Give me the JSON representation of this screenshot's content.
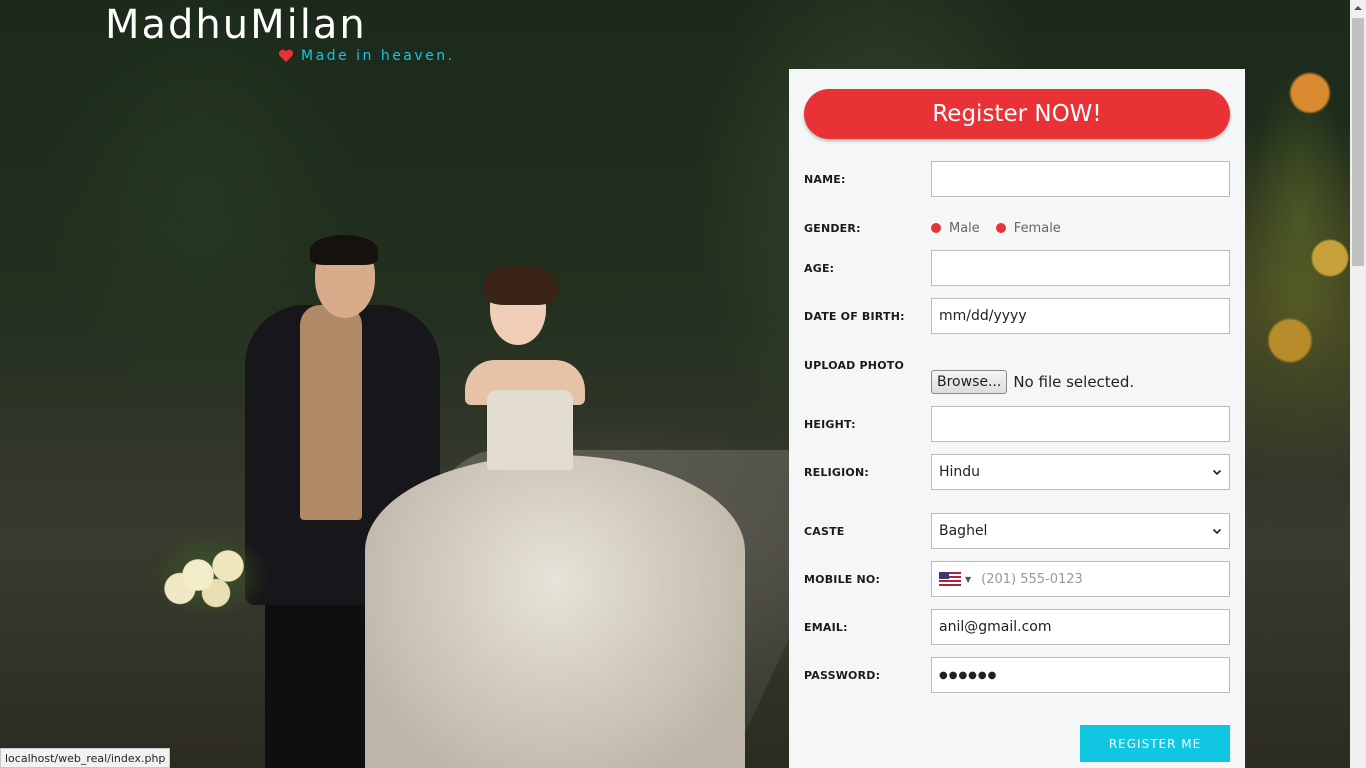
{
  "brand": {
    "title": "MadhuMilan",
    "tagline": "Made in heaven.",
    "heart_color": "#e83236",
    "tagline_color": "#17c3e6"
  },
  "form": {
    "banner": "Register NOW!",
    "accent_color": "#e83236",
    "fields": {
      "name": {
        "label": "NAME:",
        "value": ""
      },
      "gender": {
        "label": "GENDER:",
        "options": [
          "Male",
          "Female"
        ]
      },
      "age": {
        "label": "AGE:",
        "value": ""
      },
      "dob": {
        "label": "DATE OF BIRTH:",
        "value": "mm/dd/yyyy"
      },
      "photo": {
        "label": "UPLOAD PHOTO",
        "browse": "Browse...",
        "status": "No file selected."
      },
      "height": {
        "label": "HEIGHT:",
        "value": ""
      },
      "religion": {
        "label": "RELIGION:",
        "selected": "Hindu"
      },
      "caste": {
        "label": "CASTE",
        "selected": "Baghel"
      },
      "mobile": {
        "label": "MOBILE NO:",
        "placeholder": "(201) 555-0123",
        "country": "US"
      },
      "email": {
        "label": "EMAIL:",
        "value": "anil@gmail.com"
      },
      "password": {
        "label": "PASSWORD:",
        "value": "●●●●●●"
      }
    },
    "submit": "REGISTER ME",
    "submit_color": "#10c6e0"
  },
  "status_bar": {
    "url": "localhost/web_real/index.php"
  }
}
